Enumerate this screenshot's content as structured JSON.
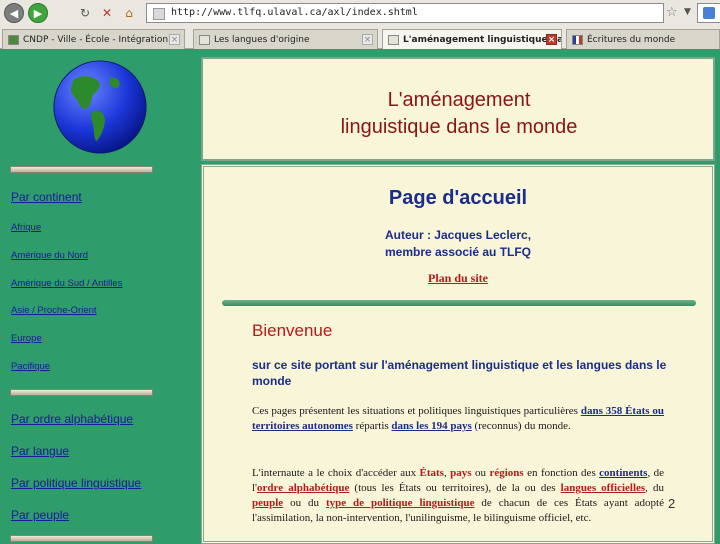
{
  "browser": {
    "url": "http://www.tlfq.ulaval.ca/axl/index.shtml",
    "tabs": [
      {
        "label": "CNDP - Ville - École - Intégration"
      },
      {
        "label": "Les langues d'origine"
      },
      {
        "label": "L'aménagement linguistique dan..."
      },
      {
        "label": "Écritures du monde"
      }
    ]
  },
  "site": {
    "title_line1": "L'aménagement",
    "title_line2": "linguistique dans le monde"
  },
  "sidebar": {
    "par_continent": "Par continent",
    "continents": [
      "Afrique",
      "Amérique du Nord",
      "Amérique du Sud / Antilles",
      "Asie / Proche-Orient",
      "Europe",
      "Pacifique"
    ],
    "par_ordre": "Par ordre alphabétique",
    "par_langue": "Par langue",
    "par_politique": "Par politique linguistique",
    "par_peuple": "Par peuple"
  },
  "main": {
    "heading": "Page d'accueil",
    "author_line1": "Auteur : Jacques Leclerc,",
    "author_line2": "membre associé au TLFQ",
    "sitemap": "Plan du site",
    "welcome": "Bienvenue",
    "subtitle": "sur ce site portant sur l'aménagement linguistique et les langues dans le monde",
    "para1": {
      "t1": "Ces pages présentent les situations et politiques linguistiques particulières ",
      "link1": "dans 358 États ou territoires autonomes",
      "t2": " répartis ",
      "link2": "dans les 194 pays",
      "t3": " (reconnus) du monde."
    },
    "para2": {
      "t1": "L'internaute a le choix d'accéder aux ",
      "b1": "États",
      "t2": ", ",
      "b2": "pays",
      "t3": " ou ",
      "b3": "régions",
      "t4": " en fonction des ",
      "link1": "continents",
      "t5": ", de l'",
      "link2": "ordre alphabétique",
      "t6": " (tous les États ou territoires), de la ou des ",
      "link3": "langues officielles",
      "t7": ", du ",
      "link4": "peuple",
      "t8": " ou du ",
      "link5": "type de politique linguistique",
      "t9": " de chacun de ces États ayant adopté l'assimilation, la non-intervention, l'unilinguisme, le bilinguisme officiel, etc."
    }
  },
  "slide_number": "2"
}
